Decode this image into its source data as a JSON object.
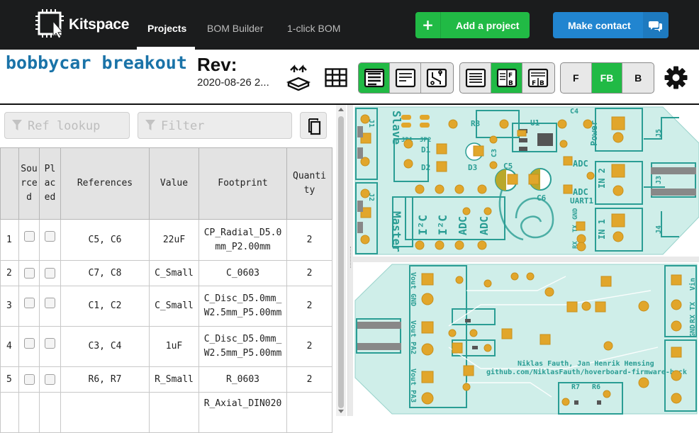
{
  "nav": {
    "brand": "Kitspace",
    "items": [
      "Projects",
      "BOM Builder",
      "1-click BOM"
    ],
    "active": "Projects",
    "add_project": "Add a project",
    "make_contact": "Make contact"
  },
  "project": {
    "title": "bobbycar breakout",
    "rev_label": "Rev:",
    "rev_date": "2020-08-26 2..."
  },
  "toolbar": {
    "layer_buttons": [
      "F",
      "FB",
      "B"
    ],
    "active_layer": "FB"
  },
  "search": {
    "ref_placeholder": "Ref lookup",
    "filter_placeholder": "Filter"
  },
  "bom": {
    "headers": {
      "sourced": [
        "Sou",
        "rce",
        "d"
      ],
      "placed": [
        "Pl",
        "ac",
        "ed"
      ],
      "references": "References",
      "value": "Value",
      "footprint": "Footprint",
      "quantity": [
        "Quanti",
        "ty"
      ]
    },
    "rows": [
      {
        "idx": "1",
        "refs": "C5, C6",
        "value": "22uF",
        "footprint": [
          "CP_Radial_D5.0",
          "mm_P2.00mm"
        ],
        "qty": "2"
      },
      {
        "idx": "2",
        "refs": "C7, C8",
        "value": "C_Small",
        "footprint": [
          "C_0603"
        ],
        "qty": "2"
      },
      {
        "idx": "3",
        "refs": "C1, C2",
        "value": "C_Small",
        "footprint": [
          "C_Disc_D5.0mm_",
          "W2.5mm_P5.00mm"
        ],
        "qty": "2"
      },
      {
        "idx": "4",
        "refs": "C3, C4",
        "value": "1uF",
        "footprint": [
          "C_Disc_D5.0mm_",
          "W2.5mm_P5.00mm"
        ],
        "qty": "2"
      },
      {
        "idx": "5",
        "refs": "R6, R7",
        "value": "R_Small",
        "footprint": [
          "R_0603"
        ],
        "qty": "2"
      },
      {
        "idx": "",
        "refs": "",
        "value": "",
        "footprint": [
          "R_Axial_DIN020"
        ],
        "qty": ""
      }
    ]
  },
  "board_front": {
    "labels": [
      "Slave",
      "Master",
      "Power",
      "UART1",
      "IN 2",
      "IN 1",
      "J1",
      "J2",
      "J3",
      "J4",
      "J5",
      "U1",
      "R3",
      "C3",
      "C4",
      "C5",
      "C6",
      "D1",
      "D2",
      "D3",
      "JP1",
      "JP2",
      "I²C",
      "I²C",
      "ADC",
      "ADC",
      "ADC",
      "ADC",
      "RX",
      "TX",
      "GND"
    ]
  },
  "board_back": {
    "labels": [
      "Vout GND",
      "Vout PA2",
      "Vout PA3",
      "Vin",
      "TX",
      "RX",
      "GND",
      "Niklas Fauth, Jan Henrik Hemsing",
      "github.com/NiklasFauth/hoverboard-firmware-hack",
      "R7",
      "R6"
    ]
  },
  "colors": {
    "nav_bg": "#1b1c1d",
    "green": "#21ba45",
    "blue": "#2185d0",
    "title": "#1a73a8",
    "board": "#cfeee9",
    "silk": "#2a9d94",
    "pad": "#e1a62b"
  }
}
